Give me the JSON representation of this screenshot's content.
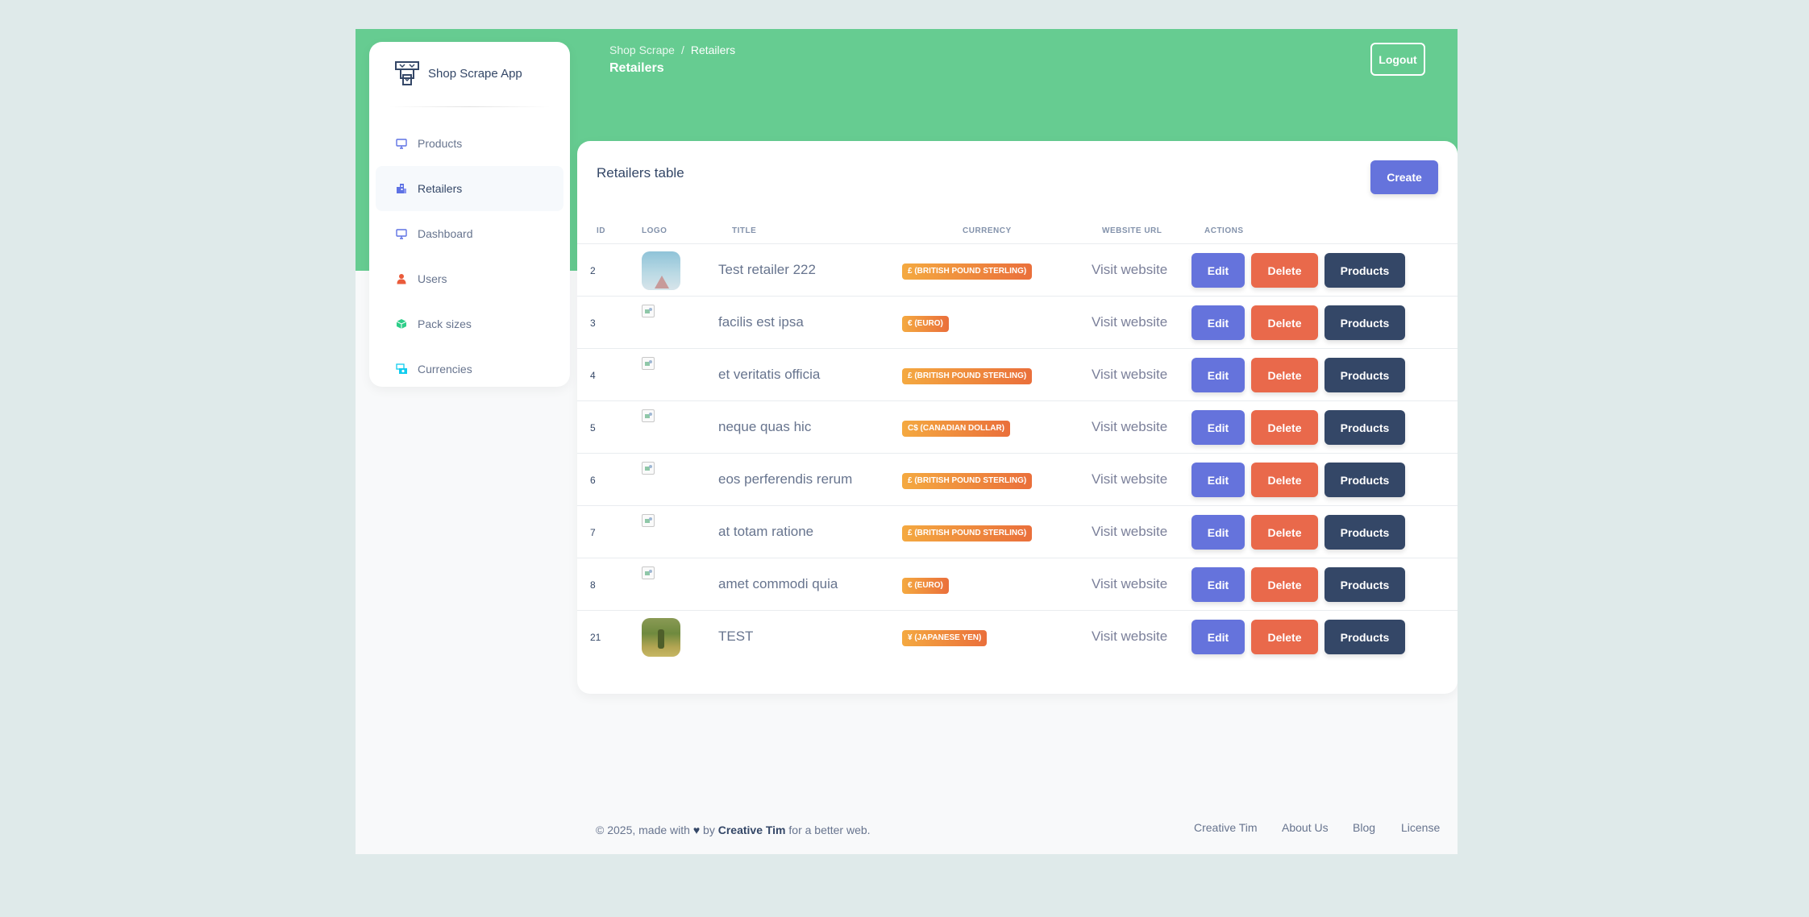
{
  "brand": {
    "name": "Shop Scrape App",
    "logo_icon": "shop-logo-icon"
  },
  "sidebar": {
    "items": [
      {
        "label": "Products",
        "icon": "monitor-icon",
        "icon_color": "#5e72e4",
        "active": false
      },
      {
        "label": "Retailers",
        "icon": "building-icon",
        "icon_color": "#5e72e4",
        "active": true
      },
      {
        "label": "Dashboard",
        "icon": "monitor-icon",
        "icon_color": "#5e72e4",
        "active": false
      },
      {
        "label": "Users",
        "icon": "user-icon",
        "icon_color": "#f5365c",
        "active": false
      },
      {
        "label": "Pack sizes",
        "icon": "box-icon",
        "icon_color": "#2dce89",
        "active": false
      },
      {
        "label": "Currencies",
        "icon": "money-icon",
        "icon_color": "#11cdef",
        "active": false
      }
    ]
  },
  "header": {
    "breadcrumb_root": "Shop Scrape",
    "breadcrumb_sep": "/",
    "breadcrumb_current": "Retailers",
    "title": "Retailers",
    "logout_label": "Logout"
  },
  "card": {
    "title": "Retailers table",
    "create_label": "Create"
  },
  "table": {
    "headers": {
      "id": "ID",
      "logo": "Logo",
      "title": "Title",
      "currency": "Currency",
      "website_url": "Website URL",
      "actions": "Actions"
    },
    "rows": [
      {
        "id": "2",
        "logo": "sky",
        "title": "Test retailer 222",
        "currency": "£ (British Pound Sterling)",
        "website": "Visit website",
        "edit": "Edit",
        "delete": "Delete",
        "products": "Products"
      },
      {
        "id": "3",
        "logo": "broken",
        "title": "facilis est ipsa",
        "currency": "€ (Euro)",
        "website": "Visit website",
        "edit": "Edit",
        "delete": "Delete",
        "products": "Products"
      },
      {
        "id": "4",
        "logo": "broken",
        "title": "et veritatis officia",
        "currency": "£ (British Pound Sterling)",
        "website": "Visit website",
        "edit": "Edit",
        "delete": "Delete",
        "products": "Products"
      },
      {
        "id": "5",
        "logo": "broken",
        "title": "neque quas hic",
        "currency": "C$ (Canadian Dollar)",
        "website": "Visit website",
        "edit": "Edit",
        "delete": "Delete",
        "products": "Products"
      },
      {
        "id": "6",
        "logo": "broken",
        "title": "eos perferendis rerum",
        "currency": "£ (British Pound Sterling)",
        "website": "Visit website",
        "edit": "Edit",
        "delete": "Delete",
        "products": "Products"
      },
      {
        "id": "7",
        "logo": "broken",
        "title": "at totam ratione",
        "currency": "£ (British Pound Sterling)",
        "website": "Visit website",
        "edit": "Edit",
        "delete": "Delete",
        "products": "Products"
      },
      {
        "id": "8",
        "logo": "broken",
        "title": "amet commodi quia",
        "currency": "€ (Euro)",
        "website": "Visit website",
        "edit": "Edit",
        "delete": "Delete",
        "products": "Products"
      },
      {
        "id": "21",
        "logo": "forest",
        "title": "TEST",
        "currency": "¥ (Japanese Yen)",
        "website": "Visit website",
        "edit": "Edit",
        "delete": "Delete",
        "products": "Products"
      }
    ]
  },
  "footer": {
    "copyright": "© 2025, made with",
    "by": "by",
    "author": "Creative Tim",
    "suffix": "for a better web.",
    "links": [
      "Creative Tim",
      "About Us",
      "Blog",
      "License"
    ]
  },
  "colors": {
    "header_green": "#66cc91",
    "primary": "#6573dc",
    "danger": "#e9694b",
    "dark": "#344767"
  }
}
